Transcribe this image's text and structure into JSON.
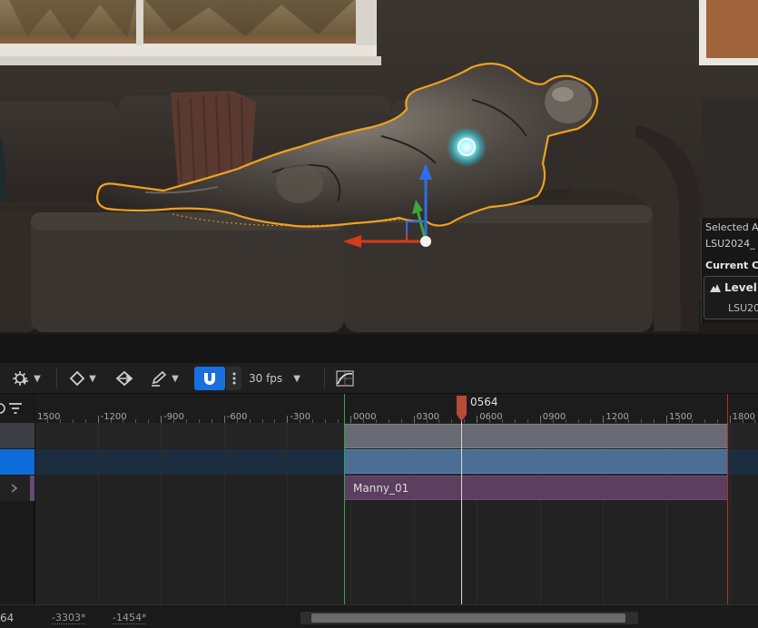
{
  "viewport": {
    "details": {
      "selected_label": "Selected A",
      "selected_value": "LSU2024_",
      "current_label": "Current Co",
      "level_label": "Level",
      "level_value": "LSU20"
    }
  },
  "toolbar": {
    "fps_label": "30 fps",
    "icons": [
      "transform-tool-icon",
      "keyframe-diamond-icon",
      "key-interp-icon",
      "pencil-icon",
      "snap-magnet-icon",
      "more-vert-icon",
      "curve-editor-icon"
    ],
    "snap_active_color": "#1a6fe0"
  },
  "timeline": {
    "ruler_labels": [
      "1500",
      "-1200",
      "-900",
      "-600",
      "-300",
      "0000",
      "0300",
      "0600",
      "0900",
      "1200",
      "1500",
      "1800"
    ],
    "playhead": "0564",
    "track_section_label": "Manny_01",
    "colors": {
      "selected_row": "#0d6cd8",
      "section_purple": "#5c3e5e",
      "playrange_start": "#2aa84a",
      "playrange_end": "#b03030"
    }
  },
  "status": {
    "frame_value": "64",
    "view_start": "-3303*",
    "view_end": "-1454*"
  }
}
